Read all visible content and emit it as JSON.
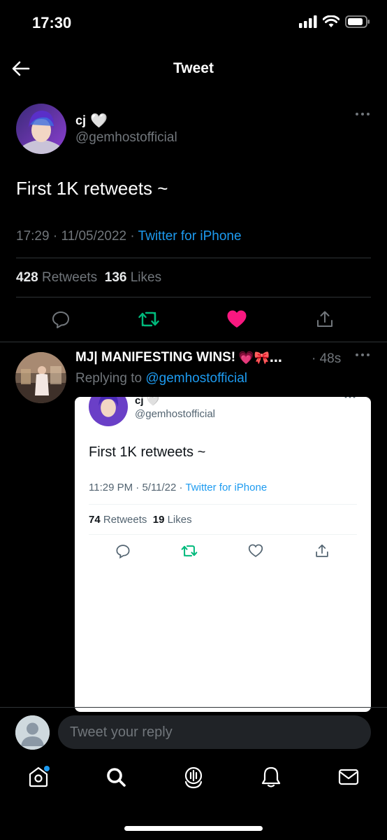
{
  "status_bar": {
    "time": "17:30"
  },
  "header": {
    "title": "Tweet"
  },
  "tweet": {
    "author_name": "cj",
    "author_emoji": "🤍",
    "author_handle": "@gemhostofficial",
    "text": "First 1K retweets ~",
    "time": "17:29",
    "date": "11/05/2022",
    "source": "Twitter for iPhone",
    "retweets_count": "428",
    "retweets_label": "Retweets",
    "likes_count": "136",
    "likes_label": "Likes"
  },
  "reply": {
    "author_name": "MJ| MANIFESTING WINS!",
    "author_emoji": "💗🎀…",
    "time": "· 48s",
    "replying_prefix": "Replying to",
    "replying_handle": "@gemhostofficial"
  },
  "embedded_tweet": {
    "author_name": "cj",
    "author_emoji": "🤍",
    "author_handle": "@gemhostofficial",
    "text": "First 1K retweets ~",
    "time": "11:29 PM",
    "date": "5/11/22",
    "source": "Twitter for iPhone",
    "retweets_count": "74",
    "retweets_label": "Retweets",
    "likes_count": "19",
    "likes_label": "Likes"
  },
  "compose": {
    "placeholder": "Tweet your reply"
  },
  "colors": {
    "accent": "#1d9bf0",
    "like": "#f91880",
    "retweet": "#00ba7c",
    "muted": "#71767b"
  },
  "tabbar": {
    "items": [
      "home-icon",
      "search-icon",
      "spaces-icon",
      "notifications-icon",
      "messages-icon"
    ]
  }
}
